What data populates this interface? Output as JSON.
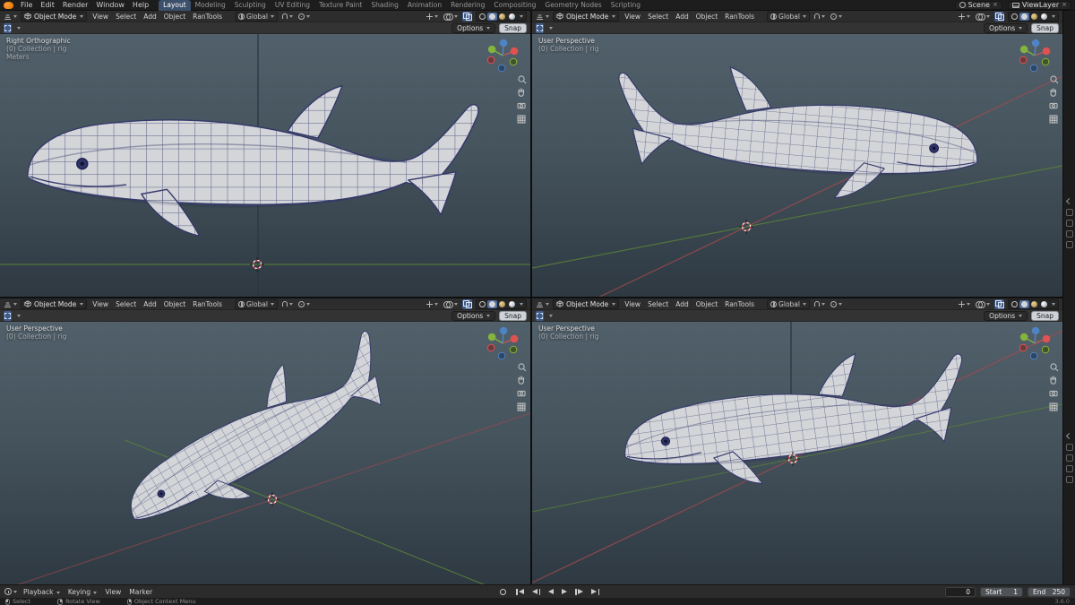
{
  "topbar": {
    "app_menus": [
      "File",
      "Edit",
      "Render",
      "Window",
      "Help"
    ],
    "workspaces": [
      "Layout",
      "Modeling",
      "Sculpting",
      "UV Editing",
      "Texture Paint",
      "Shading",
      "Animation",
      "Rendering",
      "Compositing",
      "Geometry Nodes",
      "Scripting"
    ],
    "active_workspace": "Layout",
    "scene_name": "Scene",
    "viewlayer_name": "ViewLayer"
  },
  "viewport_header": {
    "mode": "Object Mode",
    "menus": [
      "View",
      "Select",
      "Add",
      "Object",
      "RanTools"
    ],
    "orientation": "Global",
    "options_label": "Options",
    "snap_label": "Snap"
  },
  "viewports": [
    {
      "view_label": "Right Orthographic",
      "collection_label": "(0) Collection | rig",
      "extra_label": "Meters"
    },
    {
      "view_label": "User Perspective",
      "collection_label": "(0) Collection | rig",
      "extra_label": ""
    },
    {
      "view_label": "User Perspective",
      "collection_label": "(0) Collection | rig",
      "extra_label": ""
    },
    {
      "view_label": "User Perspective",
      "collection_label": "(0) Collection | rig",
      "extra_label": ""
    }
  ],
  "timeline": {
    "menus": [
      "Playback",
      "Keying",
      "View",
      "Marker"
    ],
    "current_frame": "0",
    "start_label": "Start",
    "start_value": "1",
    "end_label": "End",
    "end_value": "250"
  },
  "statusbar": {
    "hint_left": "Select",
    "hint_mid": "Rotate View",
    "hint_right": "Object Context Menu",
    "version": "3.6.0"
  },
  "colors": {
    "accent": "#4772b3",
    "axis_x": "#a34a4e",
    "axis_y": "#587f39",
    "axis_z": "#3b6ea5",
    "mesh_wire": "#454a78"
  }
}
